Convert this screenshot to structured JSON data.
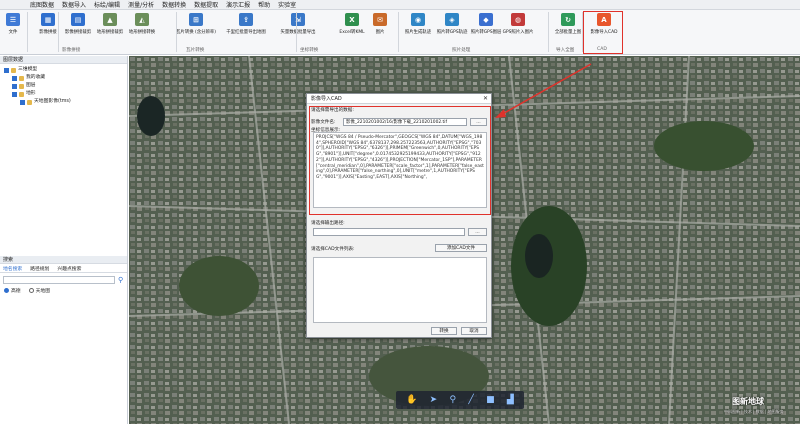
{
  "menu": [
    "底图数据",
    "数据导入",
    "标绘/编辑",
    "测量/分析",
    "数据转换",
    "数据提取",
    "演示汇报",
    "帮助",
    "实验室"
  ],
  "ribbon": {
    "file_label": "文件",
    "buttons": [
      {
        "label": "影像拼接",
        "color": "#2f6fce",
        "glyph": "▦"
      },
      {
        "label": "影像拼接裁剪",
        "color": "#2f6fce",
        "glyph": "▤"
      },
      {
        "label": "地形拼接裁剪",
        "color": "#6b8e5a",
        "glyph": "▲"
      },
      {
        "label": "地形拼接转换",
        "color": "#6b8e5a",
        "glyph": "◭"
      },
      {
        "label": "瓦片转换 (含分辨率)",
        "color": "#3a78c8",
        "glyph": "⊞"
      },
      {
        "label": "千里红批量导出地图",
        "color": "#3a78c8",
        "glyph": "⇪"
      },
      {
        "label": "矢量数据批量导出",
        "color": "#3a78c8",
        "glyph": "⇲"
      },
      {
        "label": "Excel转KML",
        "color": "#2f8f4e",
        "glyph": "X"
      },
      {
        "label": "图片",
        "color": "#c96a2a",
        "glyph": "✉"
      },
      {
        "label": "照片生成轨迹",
        "color": "#2f86c6",
        "glyph": "◉"
      },
      {
        "label": "照片转GPS轨迹",
        "color": "#2f86c6",
        "glyph": "◈"
      },
      {
        "label": "照片转GPS图层",
        "color": "#3a6fd0",
        "glyph": "◆"
      },
      {
        "label": "GPS照片入图片",
        "color": "#c23a3a",
        "glyph": "◍"
      },
      {
        "label": "全部批量上图",
        "color": "#2f9a5a",
        "glyph": "↻"
      },
      {
        "label": "影像导入CAD",
        "color": "#e8562c",
        "glyph": "A"
      }
    ],
    "groups": [
      "影像拼接",
      "瓦片转换",
      "坐标转换",
      "照片处理",
      "导入全图",
      "CAD"
    ]
  },
  "left_panel": {
    "header": "图层数据",
    "tree": [
      {
        "label": "三维模型",
        "level": 0,
        "checked": true
      },
      {
        "label": "我的收藏",
        "level": 1,
        "checked": true
      },
      {
        "label": "图层",
        "level": 1,
        "checked": true
      },
      {
        "label": "地形",
        "level": 1,
        "checked": true
      },
      {
        "label": "天地图影像(tms)",
        "level": 2,
        "checked": true
      }
    ],
    "search_header": "搜索",
    "search_tabs": [
      "地名搜索",
      "路径规划",
      "兴趣点搜索"
    ],
    "radio_options": [
      {
        "label": "高德",
        "selected": true
      },
      {
        "label": "天地图",
        "selected": false
      }
    ]
  },
  "dialog": {
    "title": "影像导入CAD",
    "close": "✕",
    "source_label": "请选择需导出的数据:",
    "file_label": "影像文件名:",
    "file_value": "影像_2210201002/16/影像下载_2210201002.tif",
    "browse": "...",
    "coord_label": "坐标信息展示:",
    "coord_text": "PROJCS[\"WGS 84 / Pseudo-Mercator\",GEOGCS[\"WGS 84\",DATUM[\"WGS_1984\",SPHEROID[\"WGS 84\",6378137,298.257223563,AUTHORITY[\"EPSG\",\"7030\"]],AUTHORITY[\"EPSG\",\"6326\"]],PRIMEM[\"Greenwich\",0,AUTHORITY[\"EPSG\",\"8901\"]],UNIT[\"degree\",0.0174532925199433,AUTHORITY[\"EPSG\",\"9122\"]],AUTHORITY[\"EPSG\",\"4326\"]],PROJECTION[\"Mercator_1SP\"],PARAMETER[\"central_meridian\",0],PARAMETER[\"scale_factor\",1],PARAMETER[\"false_easting\",0],PARAMETER[\"false_northing\",0],UNIT[\"metre\",1,AUTHORITY[\"EPSG\",\"9001\"]],AXIS[\"Easting\",EAST],AXIS[\"Northing\",",
    "output_label": "请选择输出路径:",
    "output_browse": "...",
    "cad_list_label": "请选择CAD文件列表:",
    "cad_btn": "添加CAD文件",
    "ok": "转换",
    "cancel": "取消"
  },
  "map_tools": [
    "✋",
    "➤",
    "⚲",
    "╱",
    "■",
    "▟"
  ],
  "brand": {
    "name": "图新地球",
    "sub": "中科图新 | 技术 | 数据 | 地图服务"
  }
}
